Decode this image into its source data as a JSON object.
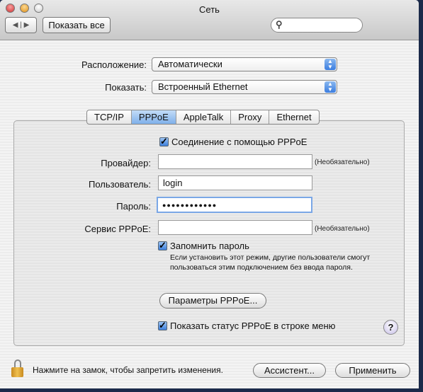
{
  "window": {
    "title": "Сеть"
  },
  "toolbar": {
    "back": "◀",
    "forward": "▶",
    "show_all": "Показать все",
    "search_placeholder": ""
  },
  "location": {
    "label": "Расположение:",
    "value": "Автоматически"
  },
  "show": {
    "label": "Показать:",
    "value": "Встроенный Ethernet"
  },
  "tabs": [
    {
      "label": "TCP/IP"
    },
    {
      "label": "PPPoE",
      "selected": true
    },
    {
      "label": "AppleTalk"
    },
    {
      "label": "Proxy"
    },
    {
      "label": "Ethernet"
    }
  ],
  "pppoe": {
    "connect_label": "Соединение с помощью PPPoE",
    "connect_checked": true,
    "provider_label": "Провайдер:",
    "provider_value": "",
    "provider_hint": "(Необязательно)",
    "user_label": "Пользователь:",
    "user_value": "login",
    "password_label": "Пароль:",
    "password_value": "●●●●●●●●●●●●",
    "service_label": "Сервис PPPoE:",
    "service_value": "",
    "service_hint": "(Необязательно)",
    "remember_label": "Запомнить пароль",
    "remember_checked": true,
    "remember_note": "Если установить этот режим, другие пользователи смогут пользоваться этим подключением без ввода пароля.",
    "options_button": "Параметры PPPoE...",
    "status_label": "Показать статус PPPoE в строке меню",
    "status_checked": true,
    "help": "?"
  },
  "footer": {
    "lock_text": "Нажмите на замок, чтобы запретить изменения.",
    "assistant": "Ассистент...",
    "apply": "Применить"
  },
  "colors": {
    "accent": "#3d7fdc",
    "close": "#e0443c",
    "minimize": "#e8a020"
  }
}
